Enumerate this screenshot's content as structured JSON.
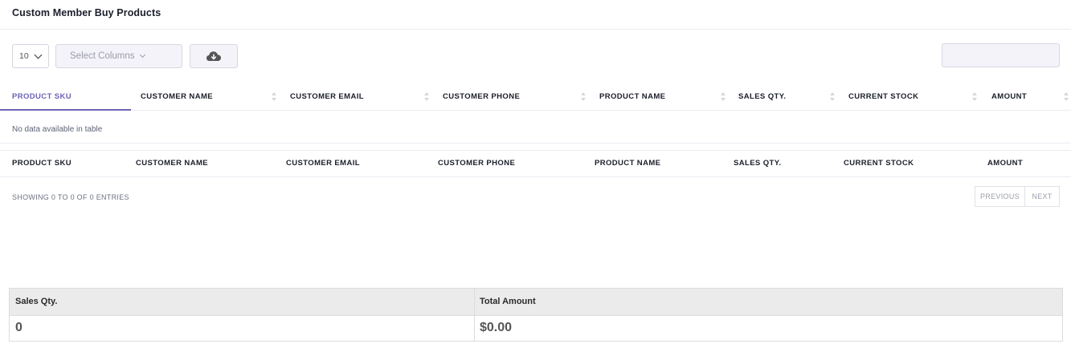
{
  "page": {
    "title": "Custom Member Buy Products"
  },
  "toolbar": {
    "length_value": "10",
    "columns_placeholder": "Select Columns",
    "download_icon": "cloud-download-icon",
    "search_value": ""
  },
  "table": {
    "columns": [
      "PRODUCT SKU",
      "CUSTOMER NAME",
      "CUSTOMER EMAIL",
      "CUSTOMER PHONE",
      "PRODUCT NAME",
      "SALES QTY.",
      "CURRENT STOCK",
      "AMOUNT"
    ],
    "footer_columns": [
      "PRODUCT SKU",
      "CUSTOMER NAME",
      "CUSTOMER EMAIL",
      "CUSTOMER PHONE",
      "PRODUCT NAME",
      "SALES QTY.",
      "CURRENT STOCK",
      "AMOUNT"
    ],
    "empty_message": "No data available in table",
    "info": "SHOWING 0 TO 0 OF 0 ENTRIES",
    "previous_label": "PREVIOUS",
    "next_label": "NEXT"
  },
  "summary": {
    "sales_qty_label": "Sales Qty.",
    "total_amount_label": "Total Amount",
    "sales_qty_value": "0",
    "total_amount_value": "$0.00"
  },
  "colors": {
    "accent": "#6b63b5",
    "header_bg": "#ebebeb"
  }
}
